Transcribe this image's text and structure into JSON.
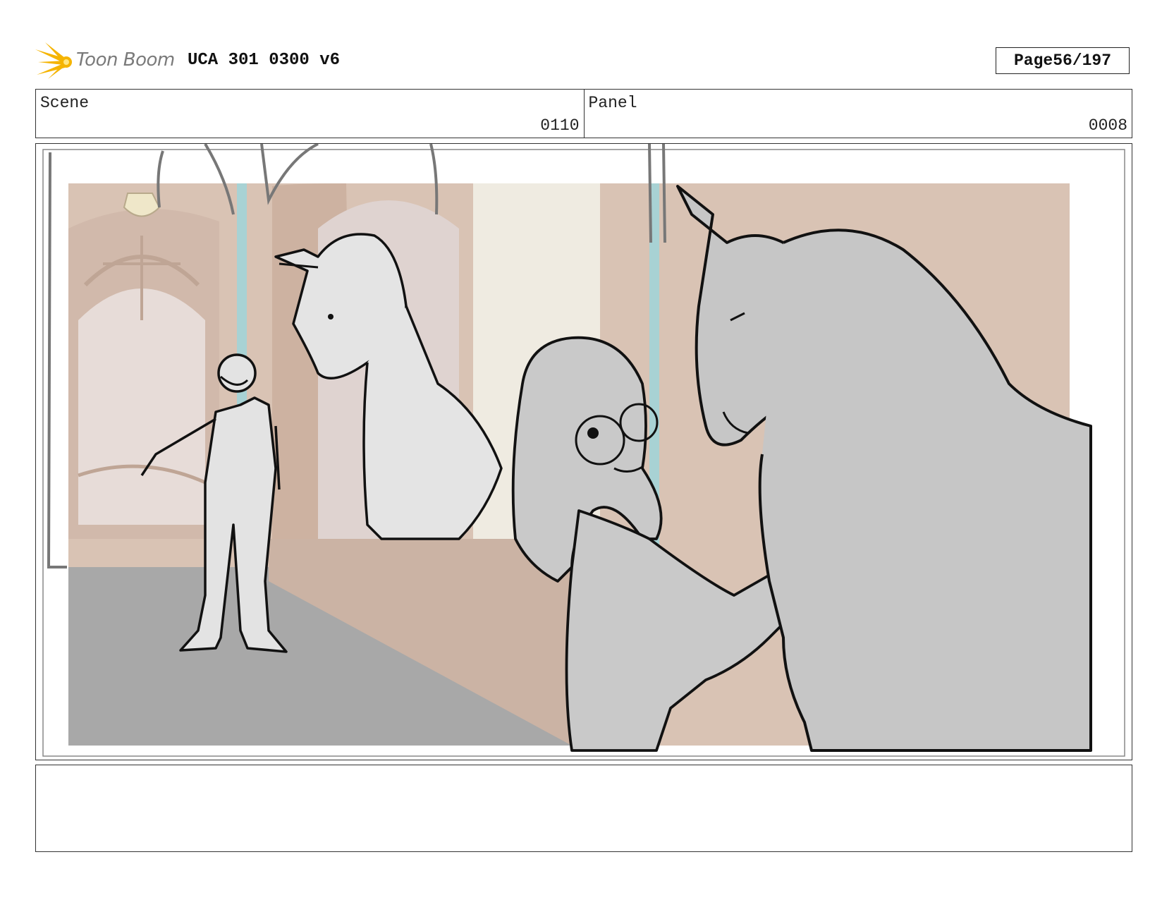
{
  "header": {
    "logo_text": "Toon Boom",
    "title": "UCA 301 0300 v6",
    "page_label": "Page",
    "page_value": "56/197"
  },
  "info": {
    "scene_label": "Scene",
    "scene_value": "0110",
    "panel_label": "Panel",
    "panel_value": "0008"
  },
  "notes": {
    "text": ""
  },
  "colors": {
    "logo_accent": "#f5b400",
    "logo_text": "#7a7a7a",
    "frame_border": "#333333"
  },
  "icons": [
    "toon-boom-logo-icon"
  ]
}
